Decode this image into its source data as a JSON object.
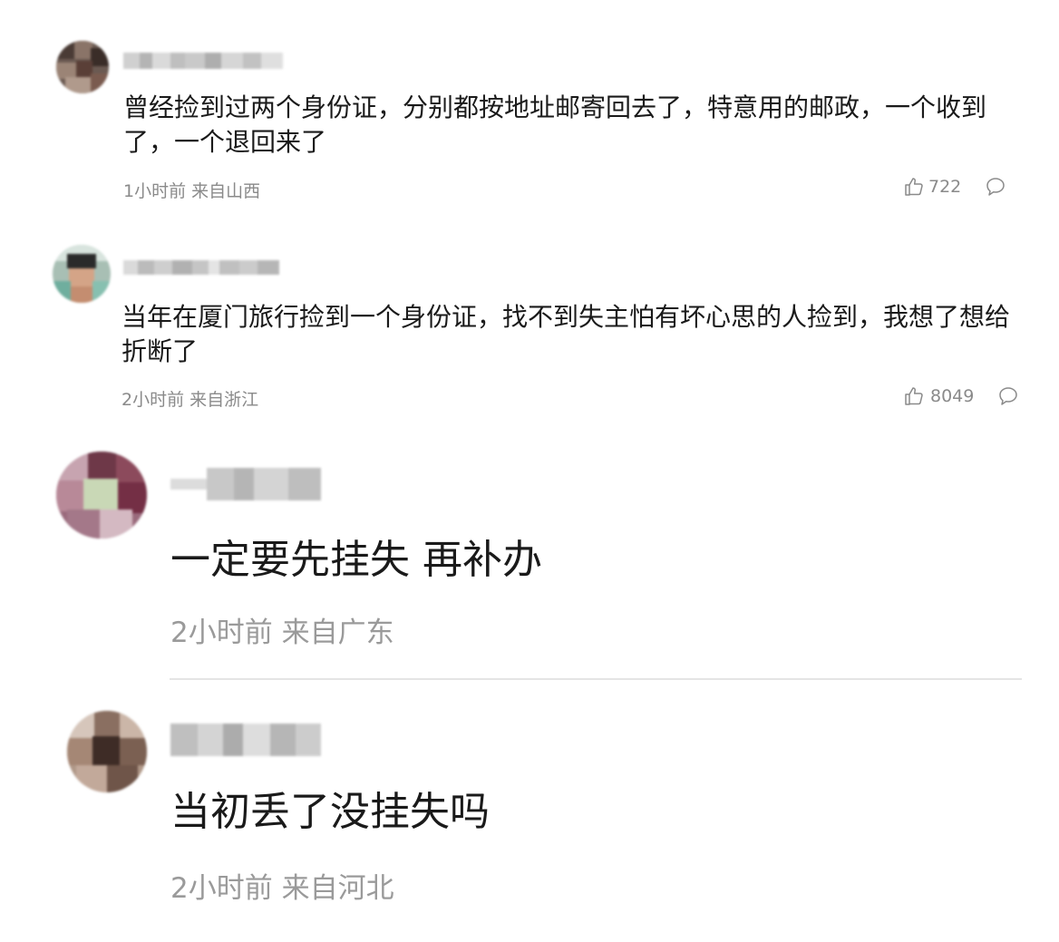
{
  "comments": [
    {
      "text": "曾经捡到过两个身份证，分别都按地址邮寄回去了，特意用的邮政，一个收到了，一个退回来了",
      "time": "1小时前",
      "location": "来自山西",
      "likes": "722"
    },
    {
      "text": "当年在厦门旅行捡到一个身份证，找不到失主怕有坏心思的人捡到，我想了想给折断了",
      "time": "2小时前",
      "location": "来自浙江",
      "likes": "8049"
    },
    {
      "text": "一定要先挂失 再补办",
      "time": "2小时前",
      "location": "来自广东"
    },
    {
      "text": "当初丢了没挂失吗",
      "time": "2小时前",
      "location": "来自河北"
    }
  ],
  "icons": {
    "like": "thumbs-up-icon",
    "reply": "comment-bubble-icon"
  },
  "colors": {
    "text": "#1a1a1a",
    "meta": "#8a8a8a",
    "divider": "#e4e4e4"
  }
}
